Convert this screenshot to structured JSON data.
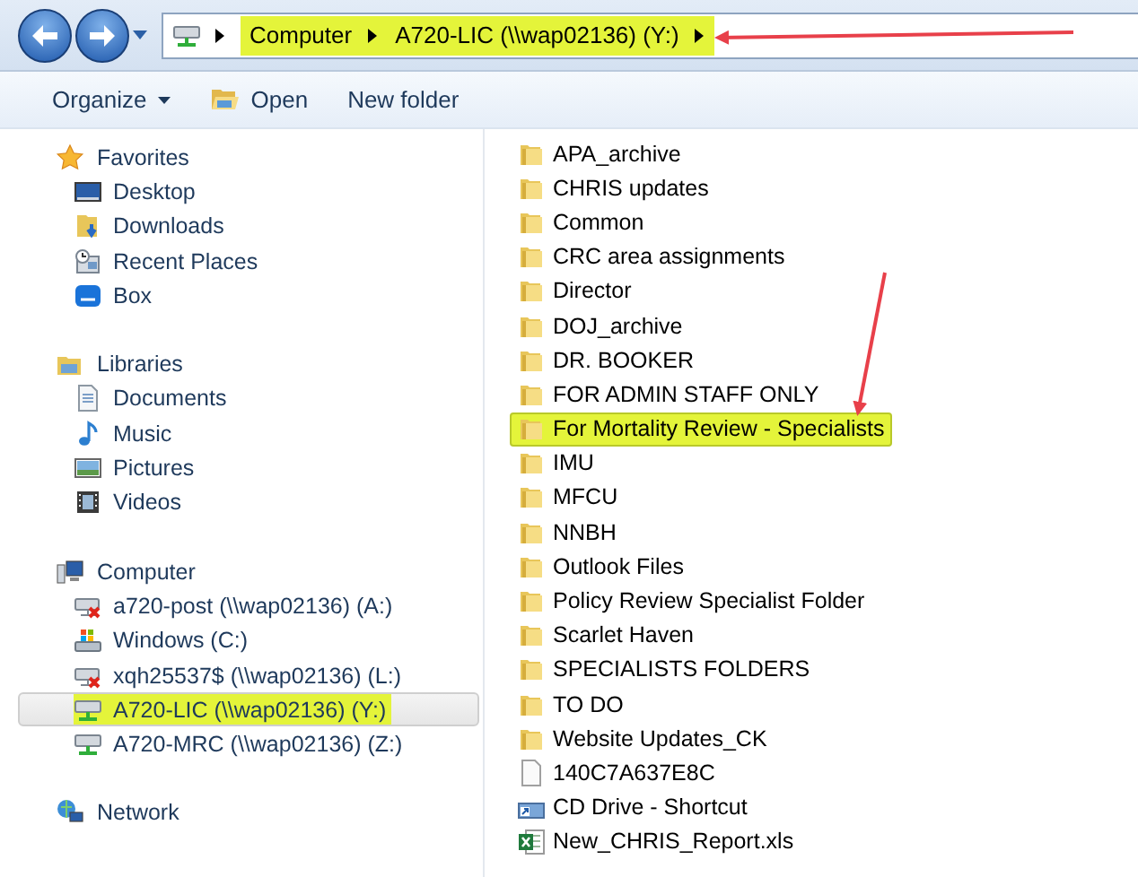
{
  "address_bar": {
    "highlighted": true,
    "crumbs": [
      "Computer",
      "A720-LIC (\\\\wap02136) (Y:)"
    ]
  },
  "toolbar": [
    {
      "kind": "menu",
      "label": "Organize"
    },
    {
      "kind": "open",
      "label": "Open"
    },
    {
      "kind": "plain",
      "label": "New folder"
    }
  ],
  "sidebar": {
    "groups": [
      {
        "label": "Favorites",
        "kind": "star",
        "children": [
          {
            "label": "Desktop",
            "kind": "desktop",
            "selected": false,
            "highlighted": false
          },
          {
            "label": "Downloads",
            "kind": "downloads",
            "selected": false,
            "highlighted": false
          },
          {
            "label": "Recent Places",
            "kind": "recent",
            "selected": false,
            "highlighted": false
          },
          {
            "label": "Box",
            "kind": "box",
            "selected": false,
            "highlighted": false
          }
        ]
      },
      {
        "label": "Libraries",
        "kind": "libraries",
        "children": [
          {
            "label": "Documents",
            "kind": "document",
            "selected": false,
            "highlighted": false
          },
          {
            "label": "Music",
            "kind": "music",
            "selected": false,
            "highlighted": false
          },
          {
            "label": "Pictures",
            "kind": "pictures",
            "selected": false,
            "highlighted": false
          },
          {
            "label": "Videos",
            "kind": "videos",
            "selected": false,
            "highlighted": false
          }
        ]
      },
      {
        "label": "Computer",
        "kind": "computer",
        "children": [
          {
            "label": "a720-post (\\\\wap02136) (A:)",
            "kind": "drive-off",
            "selected": false,
            "highlighted": false
          },
          {
            "label": "Windows (C:)",
            "kind": "drive-local",
            "selected": false,
            "highlighted": false
          },
          {
            "label": "xqh25537$ (\\\\wap02136) (L:)",
            "kind": "drive-off",
            "selected": false,
            "highlighted": false
          },
          {
            "label": "A720-LIC (\\\\wap02136) (Y:)",
            "kind": "drive-net",
            "selected": true,
            "highlighted": true
          },
          {
            "label": "A720-MRC (\\\\wap02136) (Z:)",
            "kind": "drive-net",
            "selected": false,
            "highlighted": false
          }
        ]
      },
      {
        "label": "Network",
        "kind": "network"
      }
    ]
  },
  "files": [
    {
      "name": "APA_archive",
      "kind": "folder",
      "selected": false,
      "highlighted": false
    },
    {
      "name": "CHRIS updates",
      "kind": "folder",
      "selected": false,
      "highlighted": false
    },
    {
      "name": "Common",
      "kind": "folder",
      "selected": false,
      "highlighted": false
    },
    {
      "name": "CRC area assignments",
      "kind": "folder",
      "selected": false,
      "highlighted": false
    },
    {
      "name": "Director",
      "kind": "folder",
      "selected": false,
      "highlighted": false
    },
    {
      "name": "DOJ_archive",
      "kind": "folder",
      "selected": false,
      "highlighted": false
    },
    {
      "name": "DR. BOOKER",
      "kind": "folder",
      "selected": false,
      "highlighted": false
    },
    {
      "name": "FOR ADMIN STAFF ONLY",
      "kind": "folder",
      "selected": false,
      "highlighted": false
    },
    {
      "name": "For Mortality Review - Specialists",
      "kind": "folder",
      "selected": true,
      "highlighted": true
    },
    {
      "name": "IMU",
      "kind": "folder",
      "selected": false,
      "highlighted": false
    },
    {
      "name": "MFCU",
      "kind": "folder",
      "selected": false,
      "highlighted": false
    },
    {
      "name": "NNBH",
      "kind": "folder",
      "selected": false,
      "highlighted": false
    },
    {
      "name": "Outlook Files",
      "kind": "folder",
      "selected": false,
      "highlighted": false
    },
    {
      "name": "Policy Review Specialist Folder",
      "kind": "folder",
      "selected": false,
      "highlighted": false
    },
    {
      "name": "Scarlet Haven",
      "kind": "folder",
      "selected": false,
      "highlighted": false
    },
    {
      "name": "SPECIALISTS FOLDERS",
      "kind": "folder",
      "selected": false,
      "highlighted": false
    },
    {
      "name": "TO DO",
      "kind": "folder",
      "selected": false,
      "highlighted": false
    },
    {
      "name": "Website Updates_CK",
      "kind": "folder",
      "selected": false,
      "highlighted": false
    },
    {
      "name": "140C7A637E8C",
      "kind": "file",
      "selected": false,
      "highlighted": false
    },
    {
      "name": "CD Drive - Shortcut",
      "kind": "shortcut",
      "selected": false,
      "highlighted": false
    },
    {
      "name": "New_CHRIS_Report.xls",
      "kind": "spreadsheet",
      "selected": false,
      "highlighted": false
    }
  ]
}
